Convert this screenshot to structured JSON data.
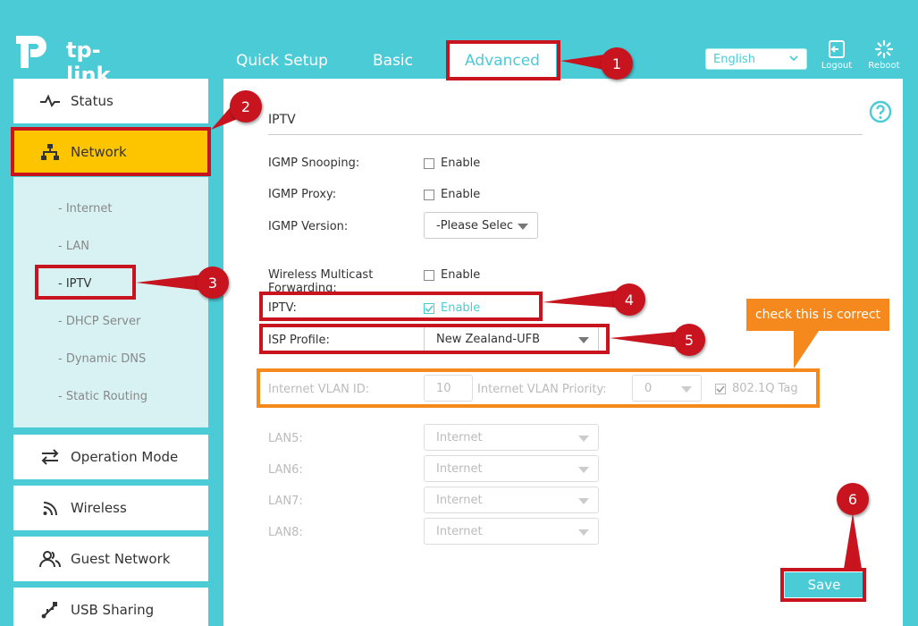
{
  "brand": {
    "name": "tp-link"
  },
  "nav": {
    "quick_setup": "Quick Setup",
    "basic": "Basic",
    "advanced": "Advanced"
  },
  "header": {
    "language": "English",
    "logout": "Logout",
    "reboot": "Reboot"
  },
  "sidebar": {
    "status": "Status",
    "network": "Network",
    "submenu": [
      "Internet",
      "LAN",
      "IPTV",
      "DHCP Server",
      "Dynamic DNS",
      "Static Routing"
    ],
    "operation_mode": "Operation Mode",
    "wireless": "Wireless",
    "guest_network": "Guest Network",
    "usb_sharing": "USB Sharing"
  },
  "iptv": {
    "title": "IPTV",
    "igmp_snooping": "IGMP Snooping:",
    "igmp_proxy": "IGMP Proxy:",
    "igmp_version": "IGMP Version:",
    "igmp_version_value": "-Please Selec",
    "wireless_multicast": "Wireless Multicast Forwarding:",
    "iptv_label": "IPTV:",
    "enable": "Enable",
    "isp_profile": "ISP Profile:",
    "isp_profile_value": "New Zealand-UFB",
    "vlan_id_label": "Internet VLAN ID:",
    "vlan_id_value": "10",
    "vlan_priority_label": "Internet VLAN Priority:",
    "vlan_priority_value": "0",
    "tag_label": "802.1Q Tag",
    "lan5": "LAN5:",
    "lan6": "LAN6:",
    "lan7": "LAN7:",
    "lan8": "LAN8:",
    "lan_value": "Internet",
    "save": "Save"
  },
  "annotations": {
    "callout": "check this is correct",
    "numbers": [
      "1",
      "2",
      "3",
      "4",
      "5",
      "6"
    ],
    "red": "#c8141e",
    "orange": "#f5891e"
  },
  "colors": {
    "accent": "#4acbd6",
    "network_active": "#fdc500"
  }
}
